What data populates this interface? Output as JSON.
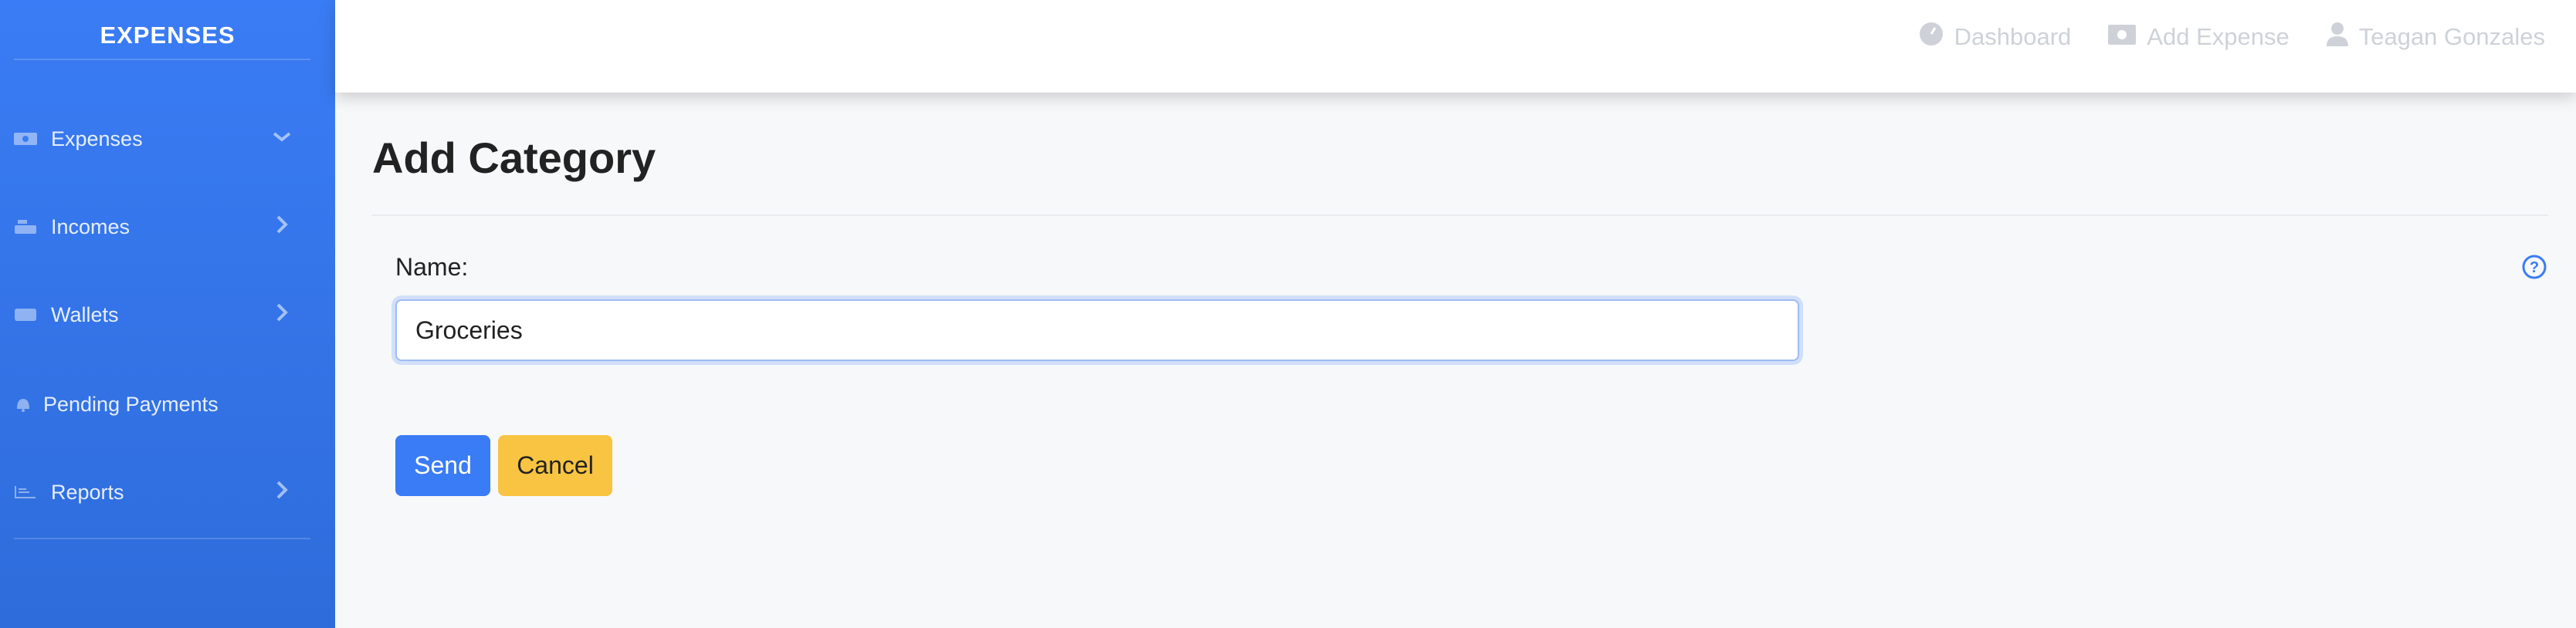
{
  "sidebar": {
    "brand": "EXPENSES",
    "items": [
      {
        "label": "Expenses",
        "icon": "money-bill-icon",
        "chevron": "down"
      },
      {
        "label": "Incomes",
        "icon": "cash-register-icon",
        "chevron": "right"
      },
      {
        "label": "Wallets",
        "icon": "wallet-icon",
        "chevron": "right"
      },
      {
        "label": "Pending Payments",
        "icon": "bell-icon",
        "chevron": null
      },
      {
        "label": "Reports",
        "icon": "chart-icon",
        "chevron": "right"
      }
    ]
  },
  "topnav": {
    "dashboard": "Dashboard",
    "add_expense": "Add Expense",
    "user": "Teagan Gonzales"
  },
  "page": {
    "title": "Add Category",
    "name_label": "Name:",
    "name_value": "Groceries",
    "send": "Send",
    "cancel": "Cancel"
  },
  "colors": {
    "primary": "#3a7cf5",
    "warning": "#f8c441"
  }
}
